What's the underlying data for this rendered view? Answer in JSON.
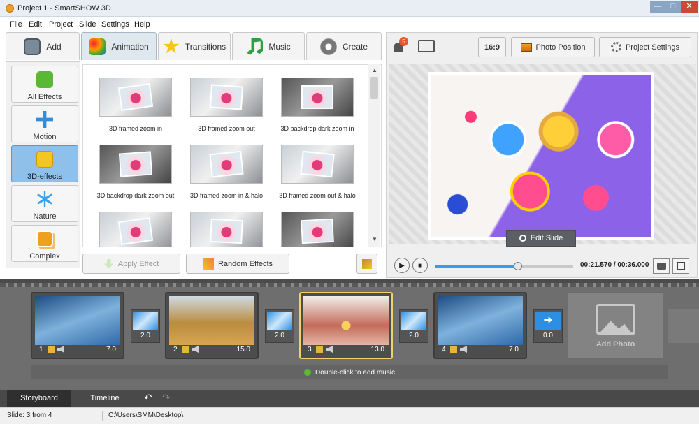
{
  "window": {
    "title": "Project 1 - SmartSHOW 3D"
  },
  "menu": [
    "File",
    "Edit",
    "Project",
    "Slide",
    "Settings",
    "Help"
  ],
  "tabs": [
    {
      "label": "Add",
      "icon": "photo-add-icon"
    },
    {
      "label": "Animation",
      "icon": "palette-icon"
    },
    {
      "label": "Transitions",
      "icon": "star-icon"
    },
    {
      "label": "Music",
      "icon": "music-note-icon"
    },
    {
      "label": "Create",
      "icon": "film-reel-icon"
    }
  ],
  "categories": [
    {
      "label": "All Effects",
      "icon": "puzzle-icon"
    },
    {
      "label": "Motion",
      "icon": "move-arrows-icon"
    },
    {
      "label": "3D-effects",
      "icon": "cube-icon"
    },
    {
      "label": "Nature",
      "icon": "snowflake-icon"
    },
    {
      "label": "Complex",
      "icon": "layers-icon"
    }
  ],
  "effects": [
    "3D framed zoom in",
    "3D framed zoom out",
    "3D backdrop dark zoom in",
    "3D backdrop dark zoom out",
    "3D framed zoom in & halo",
    "3D framed zoom out & halo"
  ],
  "buttons": {
    "apply": "Apply Effect",
    "random": "Random Effects",
    "aspect": "16:9",
    "photo_position": "Photo Position",
    "project_settings": "Project Settings",
    "edit_slide": "Edit Slide"
  },
  "notifications": {
    "count": "5"
  },
  "player": {
    "time": "00:21.570 / 00:36.000",
    "progress": 0.6
  },
  "slides": [
    {
      "num": "1",
      "duration": "7.0"
    },
    {
      "num": "2",
      "duration": "15.0"
    },
    {
      "num": "3",
      "duration": "13.0"
    },
    {
      "num": "4",
      "duration": "7.0"
    }
  ],
  "transitions": [
    "2.0",
    "2.0",
    "2.0",
    "0.0"
  ],
  "storyboard": {
    "add_photo": "Add Photo",
    "music_hint": "Double-click to add music"
  },
  "bottom_tabs": [
    "Storyboard",
    "Timeline"
  ],
  "status": {
    "slide": "Slide: 3 from 4",
    "path": "C:\\Users\\SMM\\Desktop\\"
  },
  "colors": {
    "accent": "#3a9be8",
    "active_category": "#8fc0ea",
    "selected_slide_border": "#f1d16a"
  }
}
